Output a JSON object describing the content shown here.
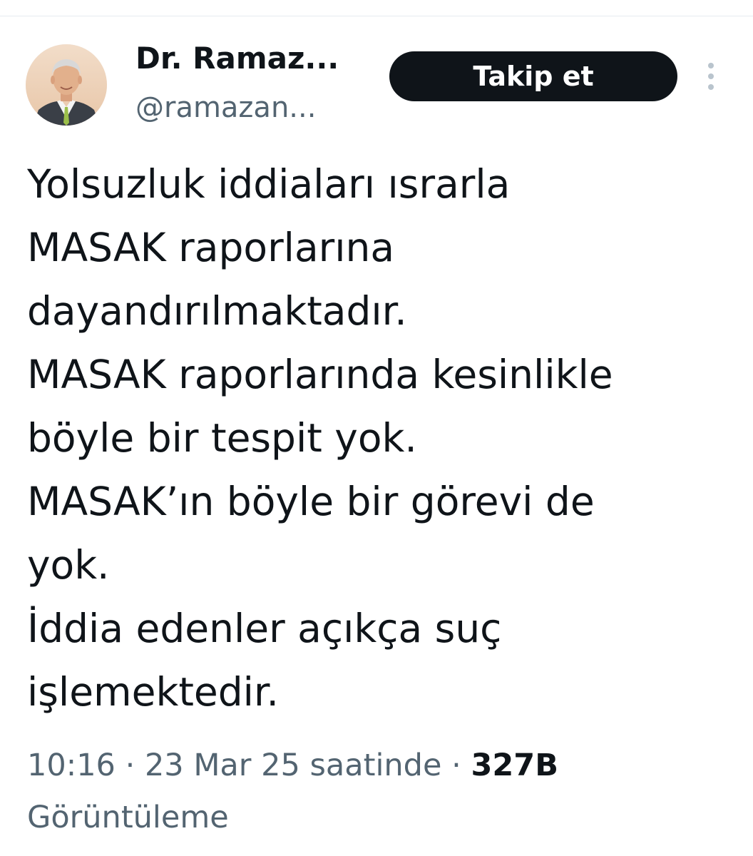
{
  "author": {
    "display_name": "Dr. Ramaz...",
    "handle": "@ramazan..."
  },
  "follow_button": {
    "label": "Takip et"
  },
  "more_options_icon": "vertical-ellipsis-icon",
  "tweet": {
    "lines": [
      "Yolsuzluk iddiaları ısrarla",
      "MASAK raporlarına",
      "dayandırılmaktadır.",
      "MASAK raporlarında kesinlikle",
      "böyle bir tespit yok.",
      "MASAK’ın böyle bir görevi de",
      "yok.",
      "İddia edenler açıkça suç",
      "işlemektedir."
    ]
  },
  "meta": {
    "time": "10:16",
    "separator": "·",
    "date": "23 Mar 25 saatinde",
    "views_count": "327B",
    "views_label": "Görüntüleme"
  },
  "colors": {
    "text_primary": "#0f1419",
    "text_secondary": "#536471",
    "button_bg": "#0f1419",
    "button_text": "#ffffff",
    "divider": "#e6ecf0"
  }
}
